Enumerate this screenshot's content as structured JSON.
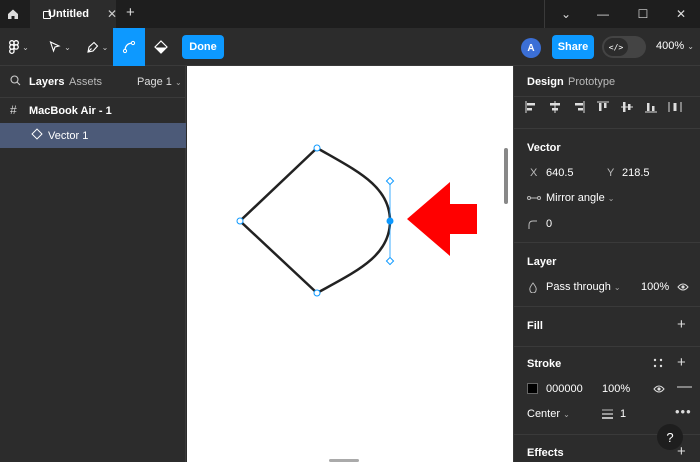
{
  "titlebar": {
    "tab_title": "Untitled",
    "close_glyph": "✕",
    "add_glyph": "+",
    "controls": [
      "⌄",
      "—",
      "☐",
      "✕"
    ]
  },
  "toolbar": {
    "done_label": "Done",
    "avatar_initial": "A",
    "share_label": "Share",
    "dev_glyph": "</>",
    "zoom_label": "400%"
  },
  "left_panel": {
    "tab_layers": "Layers",
    "tab_assets": "Assets",
    "page_label": "Page 1",
    "frame_label": "MacBook Air - 1",
    "vector_label": "Vector 1"
  },
  "right_panel": {
    "tab_design": "Design",
    "tab_prototype": "Prototype",
    "vector": {
      "title": "Vector",
      "x_label": "X",
      "x_value": "640.5",
      "y_label": "Y",
      "y_value": "218.5",
      "mirror_label": "Mirror angle",
      "radius_value": "0"
    },
    "layer": {
      "title": "Layer",
      "blend_label": "Pass through",
      "opacity": "100%"
    },
    "fill": {
      "title": "Fill"
    },
    "stroke": {
      "title": "Stroke",
      "color_hex": "000000",
      "opacity": "100%",
      "position_label": "Center",
      "weight": "1"
    },
    "effects": {
      "title": "Effects"
    },
    "help_glyph": "?"
  },
  "colors": {
    "accent": "#0d99ff",
    "arrow": "#ff0000",
    "selected_layer": "#4c5a78"
  }
}
